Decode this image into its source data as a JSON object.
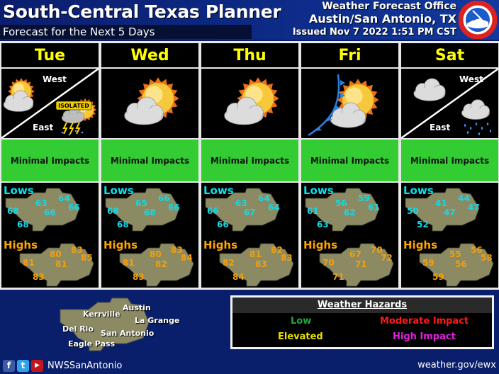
{
  "header": {
    "title": "South-Central Texas Planner",
    "subtitle": "Forecast for the Next 5 Days",
    "office_line1": "Weather Forecast Office",
    "office_line2": "Austin/San Antonio, TX",
    "issued": "Issued Nov 7 2022 1:51 PM CST",
    "logo": "nws-logo-icon"
  },
  "labels": {
    "west": "West",
    "east": "East",
    "lows": "Lows",
    "highs": "Highs",
    "isolated": "ISOLATED"
  },
  "days": [
    {
      "name": "Tue",
      "split": true,
      "west_icon": "partly-cloudy-icon",
      "east_icon": "isolated-thunderstorms-icon",
      "impact": "Minimal Impacts",
      "lows": [
        "64",
        "63",
        "66",
        "66",
        "68",
        "68"
      ],
      "highs": [
        "83",
        "80",
        "85",
        "81",
        "81",
        "83"
      ]
    },
    {
      "name": "Wed",
      "split": false,
      "icon": "mostly-sunny-icon",
      "impact": "Minimal Impacts",
      "lows": [
        "66",
        "65",
        "66",
        "68",
        "68",
        "68"
      ],
      "highs": [
        "83",
        "80",
        "84",
        "82",
        "81",
        "83"
      ]
    },
    {
      "name": "Thu",
      "split": false,
      "icon": "mostly-sunny-icon",
      "impact": "Minimal Impacts",
      "lows": [
        "64",
        "63",
        "64",
        "67",
        "66",
        "66"
      ],
      "highs": [
        "82",
        "81",
        "83",
        "83",
        "82",
        "84"
      ]
    },
    {
      "name": "Fri",
      "split": false,
      "icon": "cold-front-partly-cloudy-icon",
      "impact": "Minimal Impacts",
      "lows": [
        "59",
        "56",
        "61",
        "62",
        "61",
        "63"
      ],
      "highs": [
        "70",
        "67",
        "72",
        "71",
        "70",
        "71"
      ]
    },
    {
      "name": "Sat",
      "split": true,
      "west_icon": "cloudy-icon",
      "east_icon": "showers-icon",
      "impact": "Minimal Impacts",
      "lows": [
        "44",
        "41",
        "47",
        "47",
        "50",
        "52"
      ],
      "highs": [
        "56",
        "55",
        "58",
        "56",
        "59",
        "59"
      ]
    }
  ],
  "footer": {
    "cities": [
      "Austin",
      "Kerrville",
      "La Grange",
      "Del Rio",
      "San Antonio",
      "Eagle Pass"
    ],
    "social": [
      "facebook-icon",
      "twitter-icon",
      "youtube-icon"
    ],
    "handle": "NWSSanAntonio",
    "website": "weather.gov/ewx"
  },
  "hazards": {
    "title": "Weather Hazards",
    "levels": [
      {
        "label": "Low",
        "color": "#1faa3a"
      },
      {
        "label": "Moderate Impact",
        "color": "#ff1a1a"
      },
      {
        "label": "Elevated",
        "color": "#e8e000"
      },
      {
        "label": "High Impact",
        "color": "#e020e0"
      }
    ]
  },
  "colors": {
    "day_text": "#ffff00",
    "impact_minimal": "#33cc33",
    "lows_text": "#14d8e6",
    "highs_text": "#f0a010"
  }
}
